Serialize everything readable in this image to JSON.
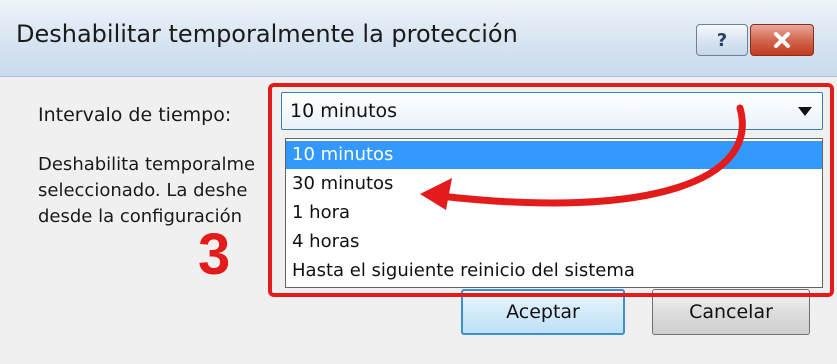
{
  "window": {
    "title": "Deshabilitar temporalmente la protección",
    "help_label": "?",
    "close_icon": "close-icon"
  },
  "interval": {
    "label": "Intervalo de tiempo:",
    "selected": "10 minutos",
    "options": [
      "10 minutos",
      "30 minutos",
      "1 hora",
      "4 horas",
      "Hasta el siguiente reinicio del sistema"
    ]
  },
  "description": {
    "lines": [
      "Deshabilita temporalme",
      "seleccionado. La deshe",
      "desde la configuración"
    ]
  },
  "buttons": {
    "ok": "Aceptar",
    "cancel": "Cancelar"
  },
  "annotation": {
    "step": "3",
    "color": "#e41b1b"
  },
  "colors": {
    "selection": "#3399ff",
    "focus_border": "#3c7fb1"
  }
}
